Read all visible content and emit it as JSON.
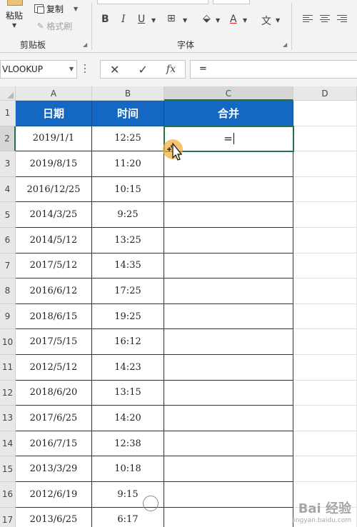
{
  "ribbon": {
    "paste_label": "粘贴",
    "copy_label": "复制",
    "format_painter_label": "格式刷",
    "clipboard_group": "剪贴板",
    "font_group": "字体",
    "bold": "B",
    "italic": "I",
    "underline": "U",
    "font_color": "A",
    "pinyin": "文"
  },
  "formula_bar": {
    "name_box": "VLOOKUP",
    "cancel": "✕",
    "enter": "✓",
    "fx": "fx",
    "formula": "="
  },
  "columns": [
    "A",
    "B",
    "C",
    "D"
  ],
  "rows": [
    "1",
    "2",
    "3",
    "4",
    "5",
    "6",
    "7",
    "8",
    "9",
    "10",
    "11",
    "12",
    "13",
    "14",
    "15",
    "16",
    "17"
  ],
  "table": {
    "headers": [
      "日期",
      "时间",
      "合并"
    ],
    "dates": [
      "2019/1/1",
      "2019/8/15",
      "2016/12/25",
      "2014/3/25",
      "2014/5/12",
      "2017/5/12",
      "2016/6/12",
      "2018/6/15",
      "2017/5/15",
      "2012/5/12",
      "2018/6/20",
      "2017/6/25",
      "2016/7/15",
      "2013/3/29",
      "2012/6/19",
      "2013/6/25"
    ],
    "times": [
      "12:25",
      "11:20",
      "10:15",
      "9:25",
      "13:25",
      "14:35",
      "17:25",
      "19:25",
      "16:12",
      "14:23",
      "13:15",
      "14:20",
      "12:38",
      "10:18",
      "9:15",
      "6:17"
    ]
  },
  "active_cell": {
    "ref": "C2",
    "value": "="
  },
  "watermark": {
    "brand": "Bai 经验",
    "url": "jingyan.baidu.com"
  },
  "colors": {
    "header_fill": "#1467c2",
    "selection": "#217346"
  }
}
